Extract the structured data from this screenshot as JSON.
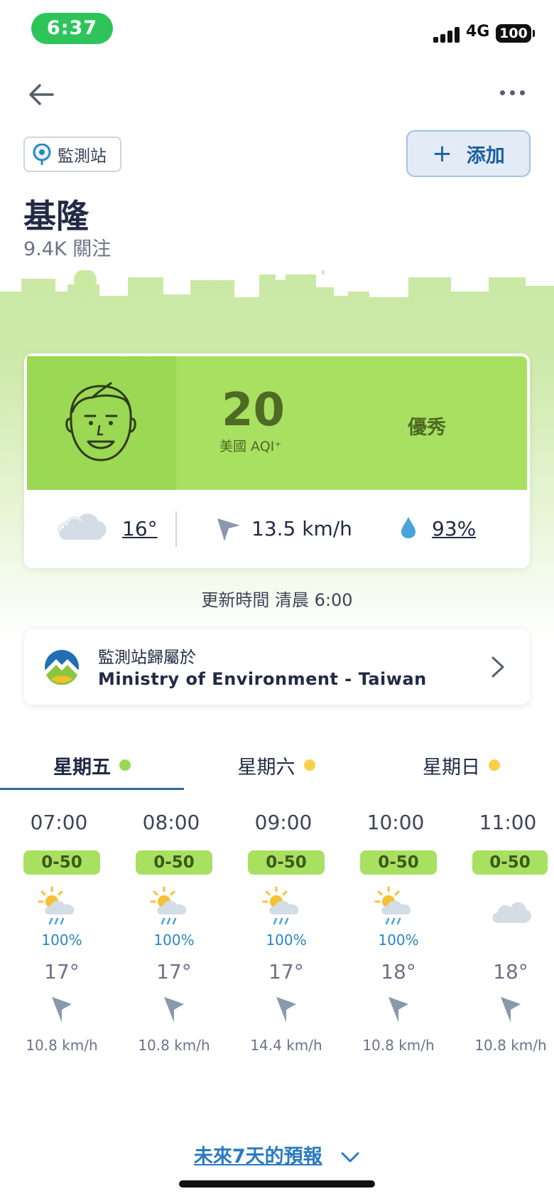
{
  "status_bar": {
    "time": "6:37",
    "network": "4G",
    "battery": "100"
  },
  "nav": {
    "back_icon": "arrow-left-icon",
    "more_icon": "more-horizontal-icon"
  },
  "station_tag": {
    "label": "監測站",
    "icon": "location-pin-icon"
  },
  "add_button": {
    "plus": "+",
    "label": "添加"
  },
  "city": {
    "name": "基隆",
    "followers": "9.4K 關注"
  },
  "aqi": {
    "value": "20",
    "unit": "美國 AQI⁺",
    "status": "優秀",
    "color": "#a8e061",
    "face_icon": "happy-face-icon"
  },
  "weather": {
    "temperature": "16°",
    "wind": "13.5 km/h",
    "humidity": "93%",
    "cloud_icon": "cloud-icon",
    "wind_icon": "wind-direction-icon",
    "humidity_icon": "water-drop-icon"
  },
  "update_time": "更新時間 清晨 6:00",
  "source": {
    "label": "監測站歸屬於",
    "name": "Ministry of Environment - Taiwan",
    "logo": "moenv-logo"
  },
  "day_tabs": [
    {
      "label": "星期五",
      "dot_color": "#9bd853",
      "active": true
    },
    {
      "label": "星期六",
      "dot_color": "#f7d14a",
      "active": false
    },
    {
      "label": "星期日",
      "dot_color": "#f7d14a",
      "active": false
    }
  ],
  "hourly": [
    {
      "time": "07:00",
      "aqi": "0-50",
      "icon": "sun-rain-cloud-icon",
      "precip": "100%",
      "temp": "17°",
      "wind": "10.8 km/h"
    },
    {
      "time": "08:00",
      "aqi": "0-50",
      "icon": "sun-rain-cloud-icon",
      "precip": "100%",
      "temp": "17°",
      "wind": "10.8 km/h"
    },
    {
      "time": "09:00",
      "aqi": "0-50",
      "icon": "sun-rain-cloud-icon",
      "precip": "100%",
      "temp": "17°",
      "wind": "14.4 km/h"
    },
    {
      "time": "10:00",
      "aqi": "0-50",
      "icon": "sun-rain-cloud-icon",
      "precip": "100%",
      "temp": "18°",
      "wind": "10.8 km/h"
    },
    {
      "time": "11:00",
      "aqi": "0-50",
      "icon": "cloud-icon",
      "precip": "",
      "temp": "18°",
      "wind": "10.8 km/h"
    }
  ],
  "forecast_link": {
    "label": "未來7天的預報",
    "icon": "chevron-down-icon"
  }
}
